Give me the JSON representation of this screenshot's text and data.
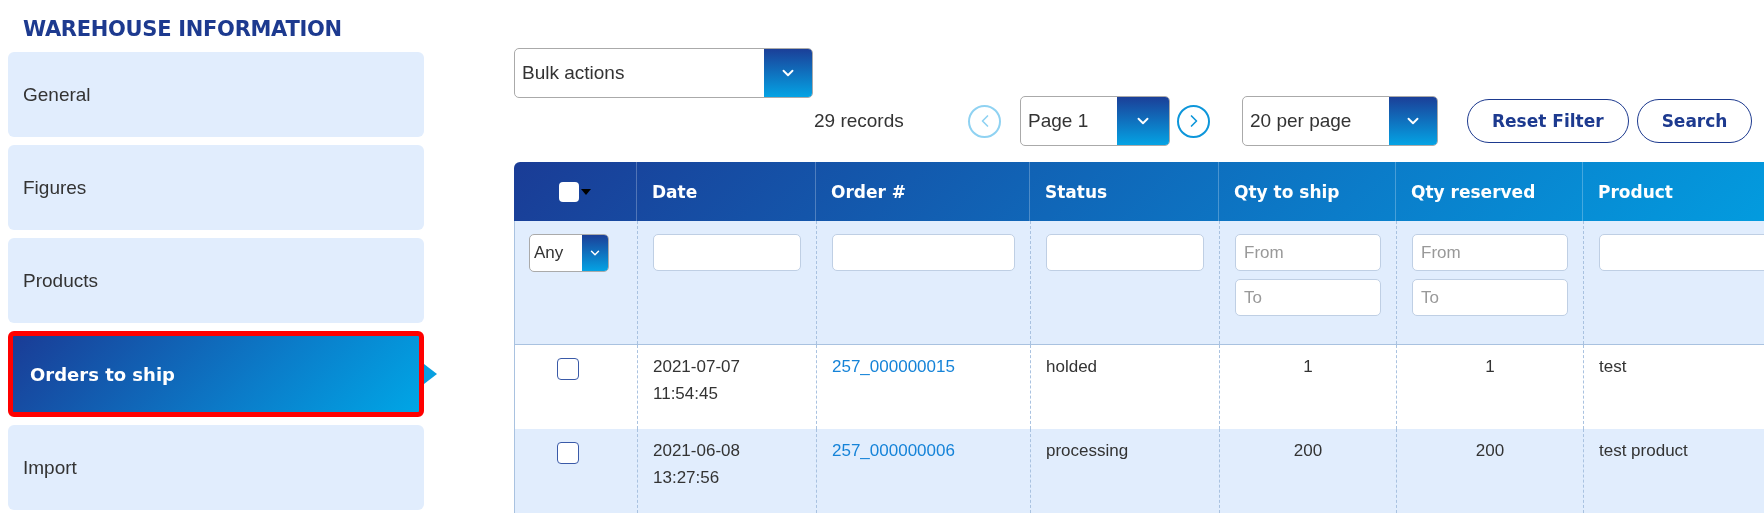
{
  "title": "WAREHOUSE INFORMATION",
  "sidebar": {
    "items": [
      {
        "label": "General",
        "selected": false
      },
      {
        "label": "Figures",
        "selected": false
      },
      {
        "label": "Products",
        "selected": false
      },
      {
        "label": "Orders to ship",
        "selected": true
      },
      {
        "label": "Import",
        "selected": false
      }
    ]
  },
  "bulk_actions": {
    "value": "Bulk actions"
  },
  "pager": {
    "records": "29 records",
    "prev": {
      "disabled": true
    },
    "page": "Page 1",
    "next": {
      "disabled": false
    },
    "per_page": "20 per page"
  },
  "buttons": [
    "Reset Filter",
    "Search"
  ],
  "table": {
    "select_all": {
      "checked": false
    },
    "columns": [
      "Date",
      "Order #",
      "Status",
      "Qty to ship",
      "Qty reserved",
      "Product"
    ],
    "filters": [
      {
        "kind": "select",
        "value": "Any"
      },
      {
        "kind": "text"
      },
      {
        "kind": "text"
      },
      {
        "kind": "text"
      },
      {
        "kind": "range",
        "placeholders": [
          "From",
          "To"
        ]
      },
      {
        "kind": "range",
        "placeholders": [
          "From",
          "To"
        ]
      },
      {
        "kind": "text"
      }
    ],
    "rows": [
      {
        "checked": false,
        "date": "2021-07-07 11:54:45",
        "order": "257_000000015",
        "status": "holded",
        "qty_to_ship": "1",
        "qty_reserved": "1",
        "product": "test"
      },
      {
        "checked": false,
        "date": "2021-06-08 13:27:56",
        "order": "257_000000006",
        "status": "processing",
        "qty_to_ship": "200",
        "qty_reserved": "200",
        "product": "test product"
      }
    ]
  }
}
